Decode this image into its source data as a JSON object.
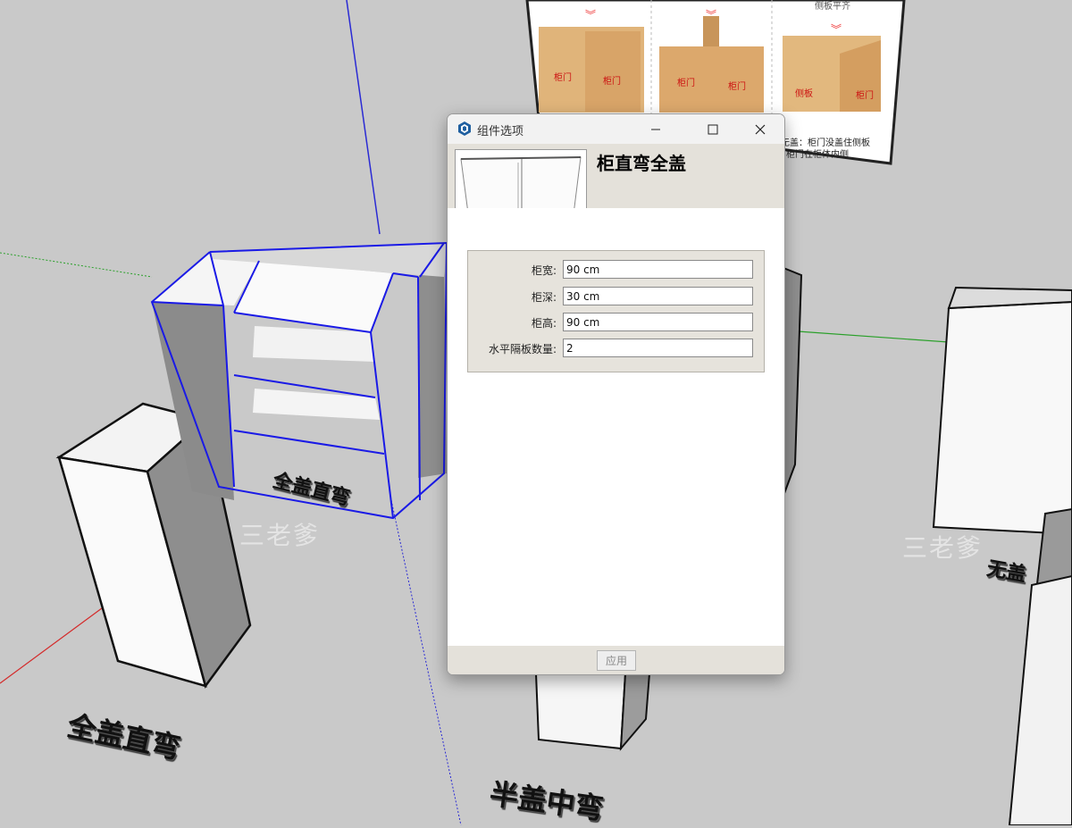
{
  "dialog": {
    "title": "组件选项",
    "component_name": "柜直弯全盖",
    "fields": [
      {
        "label": "柜宽:",
        "value": "90 cm"
      },
      {
        "label": "柜深:",
        "value": "30 cm"
      },
      {
        "label": "柜高:",
        "value": "90 cm"
      },
      {
        "label": "水平隔板数量:",
        "value": "2"
      }
    ],
    "apply_label": "应用"
  },
  "scene": {
    "labels": [
      "全盖直弯",
      "全盖直弯",
      "半盖中弯",
      "无盖"
    ],
    "watermark": "三老爹",
    "reference_photo": {
      "top_caption": "侧板平齐",
      "door_label": "柜门",
      "side_label": "侧板",
      "caption_line1": "无盖：柜门没盖住侧板",
      "caption_line2": "柜门在柜体内侧"
    }
  },
  "colors": {
    "background": "#c9c9c9",
    "selection": "#1a1ae6",
    "axis_red": "#d42a2a",
    "axis_green": "#2aa02a",
    "axis_blue": "#2a2ad4",
    "dialog_body": "#e4e1da"
  }
}
